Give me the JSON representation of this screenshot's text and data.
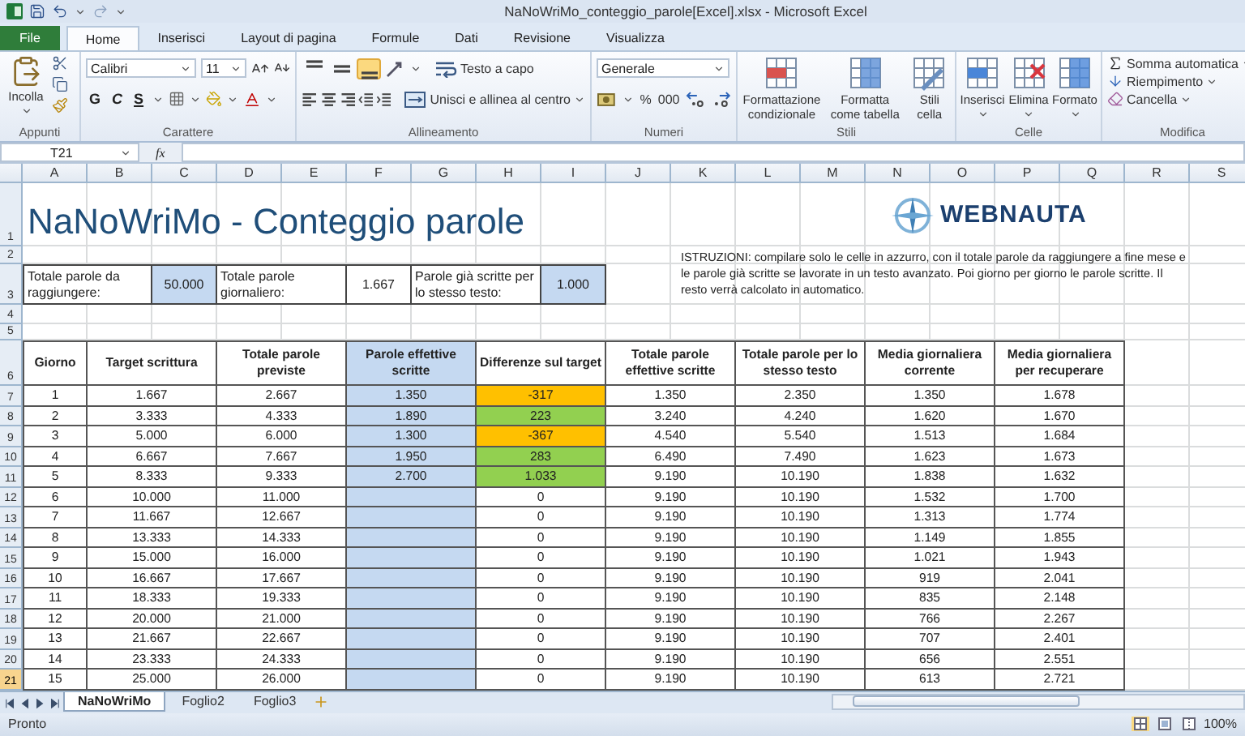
{
  "window": {
    "title": "NaNoWriMo_conteggio_parole[Excel].xlsx  -  Microsoft Excel"
  },
  "tabs": [
    {
      "label": "File",
      "kind": "file",
      "selected": false
    },
    {
      "label": "Home",
      "kind": "tab",
      "selected": true
    },
    {
      "label": "Inserisci",
      "kind": "tab",
      "selected": false
    },
    {
      "label": "Layout di pagina",
      "kind": "tab",
      "selected": false
    },
    {
      "label": "Formule",
      "kind": "tab",
      "selected": false
    },
    {
      "label": "Dati",
      "kind": "tab",
      "selected": false
    },
    {
      "label": "Revisione",
      "kind": "tab",
      "selected": false
    },
    {
      "label": "Visualizza",
      "kind": "tab",
      "selected": false
    }
  ],
  "ribbon": {
    "appunti": {
      "label": "Appunti",
      "paste": "Incolla"
    },
    "carattere": {
      "label": "Carattere",
      "font": "Calibri",
      "size": "11",
      "bold": "G",
      "italic": "C",
      "underline": "S"
    },
    "allineamento": {
      "label": "Allineamento",
      "wrap": "Testo a capo",
      "merge": "Unisci e allinea al centro",
      "vertical_align": [
        {
          "selected": false
        },
        {
          "selected": false
        },
        {
          "selected": true
        }
      ]
    },
    "numeri": {
      "label": "Numeri",
      "format": "Generale",
      "percent": "%",
      "thousands": "000"
    },
    "stili": {
      "label": "Stili",
      "buttons": [
        "Formattazione condizionale",
        "Formatta come tabella",
        "Stili cella"
      ]
    },
    "celle": {
      "label": "Celle",
      "buttons": [
        "Inserisci",
        "Elimina",
        "Formato"
      ]
    },
    "modifica": {
      "label": "Modifica",
      "buttons": [
        "Somma automatica",
        "Riempimento",
        "Cancella"
      ]
    }
  },
  "formula_bar": {
    "name_box": "T21",
    "fx": "fx"
  },
  "column_headers": [
    "A",
    "B",
    "C",
    "D",
    "E",
    "F",
    "G",
    "H",
    "I",
    "J",
    "K",
    "L",
    "M",
    "N",
    "O",
    "P",
    "Q",
    "R",
    "S"
  ],
  "row_headers": [
    {
      "label": "1",
      "selected": false
    },
    {
      "label": "2",
      "selected": false
    },
    {
      "label": "3",
      "selected": false
    },
    {
      "label": "4",
      "selected": false
    },
    {
      "label": "5",
      "selected": false
    },
    {
      "label": "6",
      "selected": false
    },
    {
      "label": "7",
      "selected": false
    },
    {
      "label": "8",
      "selected": false
    },
    {
      "label": "9",
      "selected": false
    },
    {
      "label": "10",
      "selected": false
    },
    {
      "label": "11",
      "selected": false
    },
    {
      "label": "12",
      "selected": false
    },
    {
      "label": "13",
      "selected": false
    },
    {
      "label": "14",
      "selected": false
    },
    {
      "label": "15",
      "selected": false
    },
    {
      "label": "16",
      "selected": false
    },
    {
      "label": "17",
      "selected": false
    },
    {
      "label": "18",
      "selected": false
    },
    {
      "label": "19",
      "selected": false
    },
    {
      "label": "20",
      "selected": false
    },
    {
      "label": "21",
      "selected": true
    }
  ],
  "sheet_title": "NaNoWriMo - Conteggio parole",
  "logo": {
    "text": "WEBNAUTA"
  },
  "summary": [
    {
      "text": "Totale parole da raggiungere:",
      "kind": "label"
    },
    {
      "text": "50.000",
      "kind": "input"
    },
    {
      "text": "Totale parole giornaliero:",
      "kind": "label"
    },
    {
      "text": "1.667",
      "kind": "value"
    },
    {
      "text": "Parole già scritte per lo stesso testo:",
      "kind": "label"
    },
    {
      "text": "1.000",
      "kind": "input"
    }
  ],
  "instructions": "ISTRUZIONI: compilare solo le celle in azzurro, con il totale parole da raggiungere a fine mese e le parole già scritte se lavorate in un testo avanzato. Poi giorno per giorno le parole scritte. Il resto verrà calcolato in automatico.",
  "table": {
    "columns": [
      {
        "label": "Giorno",
        "input": false
      },
      {
        "label": "Target scrittura",
        "input": false
      },
      {
        "label": "Totale parole previste",
        "input": false
      },
      {
        "label": "Parole effettive scritte",
        "input": true
      },
      {
        "label": "Differenze sul target",
        "input": false
      },
      {
        "label": "Totale parole effettive scritte",
        "input": false
      },
      {
        "label": "Totale parole per lo stesso testo",
        "input": false
      },
      {
        "label": "Media giornaliera corrente",
        "input": false
      },
      {
        "label": "Media giornaliera per recuperare",
        "input": false
      }
    ],
    "rows": [
      {
        "day": "1",
        "target": "1.667",
        "planned": "2.667",
        "actual": "1.350",
        "diff": "-317",
        "color": "#ffc000",
        "total_actual": "1.350",
        "total_text": "2.350",
        "avg_current": "1.350",
        "avg_recover": "1.678"
      },
      {
        "day": "2",
        "target": "3.333",
        "planned": "4.333",
        "actual": "1.890",
        "diff": "223",
        "color": "#92d050",
        "total_actual": "3.240",
        "total_text": "4.240",
        "avg_current": "1.620",
        "avg_recover": "1.670"
      },
      {
        "day": "3",
        "target": "5.000",
        "planned": "6.000",
        "actual": "1.300",
        "diff": "-367",
        "color": "#ffc000",
        "total_actual": "4.540",
        "total_text": "5.540",
        "avg_current": "1.513",
        "avg_recover": "1.684"
      },
      {
        "day": "4",
        "target": "6.667",
        "planned": "7.667",
        "actual": "1.950",
        "diff": "283",
        "color": "#92d050",
        "total_actual": "6.490",
        "total_text": "7.490",
        "avg_current": "1.623",
        "avg_recover": "1.673"
      },
      {
        "day": "5",
        "target": "8.333",
        "planned": "9.333",
        "actual": "2.700",
        "diff": "1.033",
        "color": "#92d050",
        "total_actual": "9.190",
        "total_text": "10.190",
        "avg_current": "1.838",
        "avg_recover": "1.632"
      },
      {
        "day": "6",
        "target": "10.000",
        "planned": "11.000",
        "diff": "0",
        "total_actual": "9.190",
        "total_text": "10.190",
        "avg_current": "1.532",
        "avg_recover": "1.700"
      },
      {
        "day": "7",
        "target": "11.667",
        "planned": "12.667",
        "diff": "0",
        "total_actual": "9.190",
        "total_text": "10.190",
        "avg_current": "1.313",
        "avg_recover": "1.774"
      },
      {
        "day": "8",
        "target": "13.333",
        "planned": "14.333",
        "diff": "0",
        "total_actual": "9.190",
        "total_text": "10.190",
        "avg_current": "1.149",
        "avg_recover": "1.855"
      },
      {
        "day": "9",
        "target": "15.000",
        "planned": "16.000",
        "diff": "0",
        "total_actual": "9.190",
        "total_text": "10.190",
        "avg_current": "1.021",
        "avg_recover": "1.943"
      },
      {
        "day": "10",
        "target": "16.667",
        "planned": "17.667",
        "diff": "0",
        "total_actual": "9.190",
        "total_text": "10.190",
        "avg_current": "919",
        "avg_recover": "2.041"
      },
      {
        "day": "11",
        "target": "18.333",
        "planned": "19.333",
        "diff": "0",
        "total_actual": "9.190",
        "total_text": "10.190",
        "avg_current": "835",
        "avg_recover": "2.148"
      },
      {
        "day": "12",
        "target": "20.000",
        "planned": "21.000",
        "diff": "0",
        "total_actual": "9.190",
        "total_text": "10.190",
        "avg_current": "766",
        "avg_recover": "2.267"
      },
      {
        "day": "13",
        "target": "21.667",
        "planned": "22.667",
        "diff": "0",
        "total_actual": "9.190",
        "total_text": "10.190",
        "avg_current": "707",
        "avg_recover": "2.401"
      },
      {
        "day": "14",
        "target": "23.333",
        "planned": "24.333",
        "diff": "0",
        "total_actual": "9.190",
        "total_text": "10.190",
        "avg_current": "656",
        "avg_recover": "2.551"
      },
      {
        "day": "15",
        "target": "25.000",
        "planned": "26.000",
        "diff": "0",
        "total_actual": "9.190",
        "total_text": "10.190",
        "avg_current": "613",
        "avg_recover": "2.721"
      }
    ]
  },
  "sheet_tabs": [
    {
      "label": "NaNoWriMo",
      "selected": true
    },
    {
      "label": "Foglio2",
      "selected": false
    },
    {
      "label": "Foglio3",
      "selected": false
    }
  ],
  "status_bar": {
    "status": "Pronto",
    "zoom": "100%",
    "views": [
      {
        "selected": true
      },
      {
        "selected": false
      },
      {
        "selected": false
      }
    ]
  }
}
